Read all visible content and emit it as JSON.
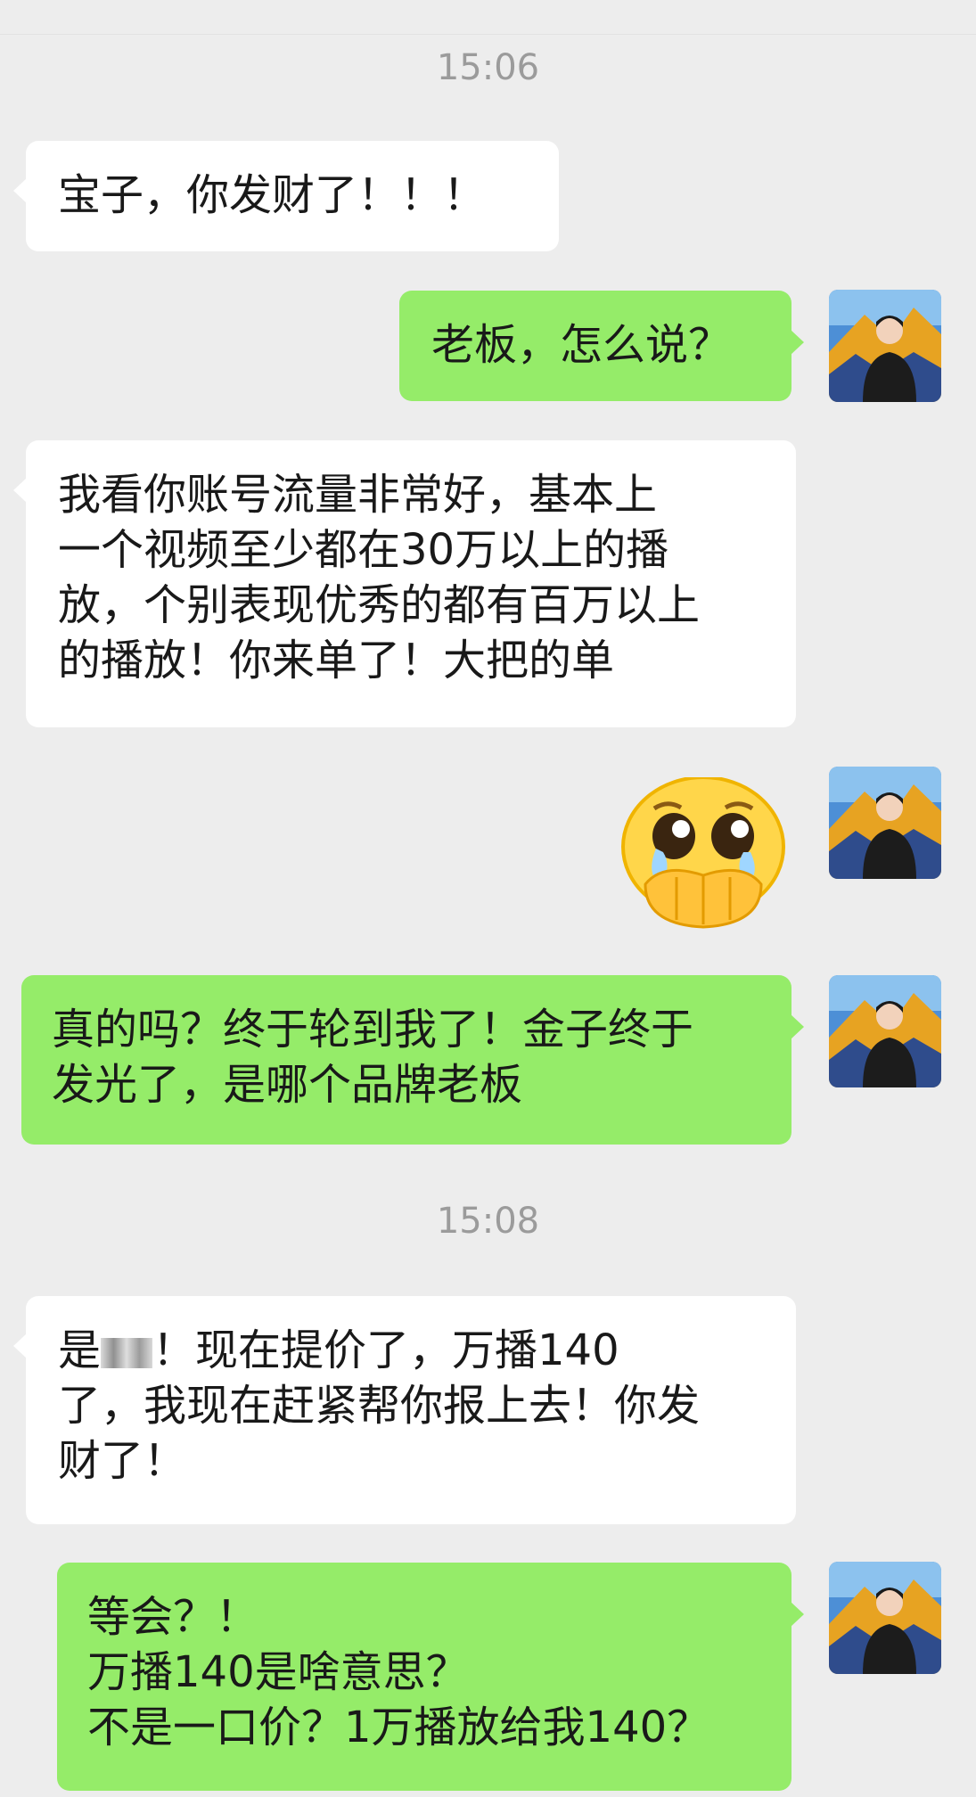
{
  "timestamps": [
    "15:06",
    "15:08"
  ],
  "messages": {
    "m1": "宝子，你发财了！！！",
    "m2": "老板，怎么说？",
    "m3": "我看你账号流量非常好，基本上\n一个视频至少都在30万以上的播\n放，个别表现优秀的都有百万以上\n的播放！你来单了！大把的单",
    "m4_sticker": "crying-face-covering-mouth-emoji",
    "m5": "真的吗？终于轮到我了！金子终于\n发光了，是哪个品牌老板",
    "m6_prefix": "是",
    "m6_suffix": "！现在提价了，万播140\n了，我现在赶紧帮你报上去！你发\n财了！",
    "m7": "等会？！\n万播140是啥意思？\n不是一口价？1万播放给我140？"
  },
  "colors": {
    "background": "#ededed",
    "incoming_bubble": "#ffffff",
    "outgoing_bubble": "#95ec69",
    "timestamp_text": "#9b9b9b"
  }
}
